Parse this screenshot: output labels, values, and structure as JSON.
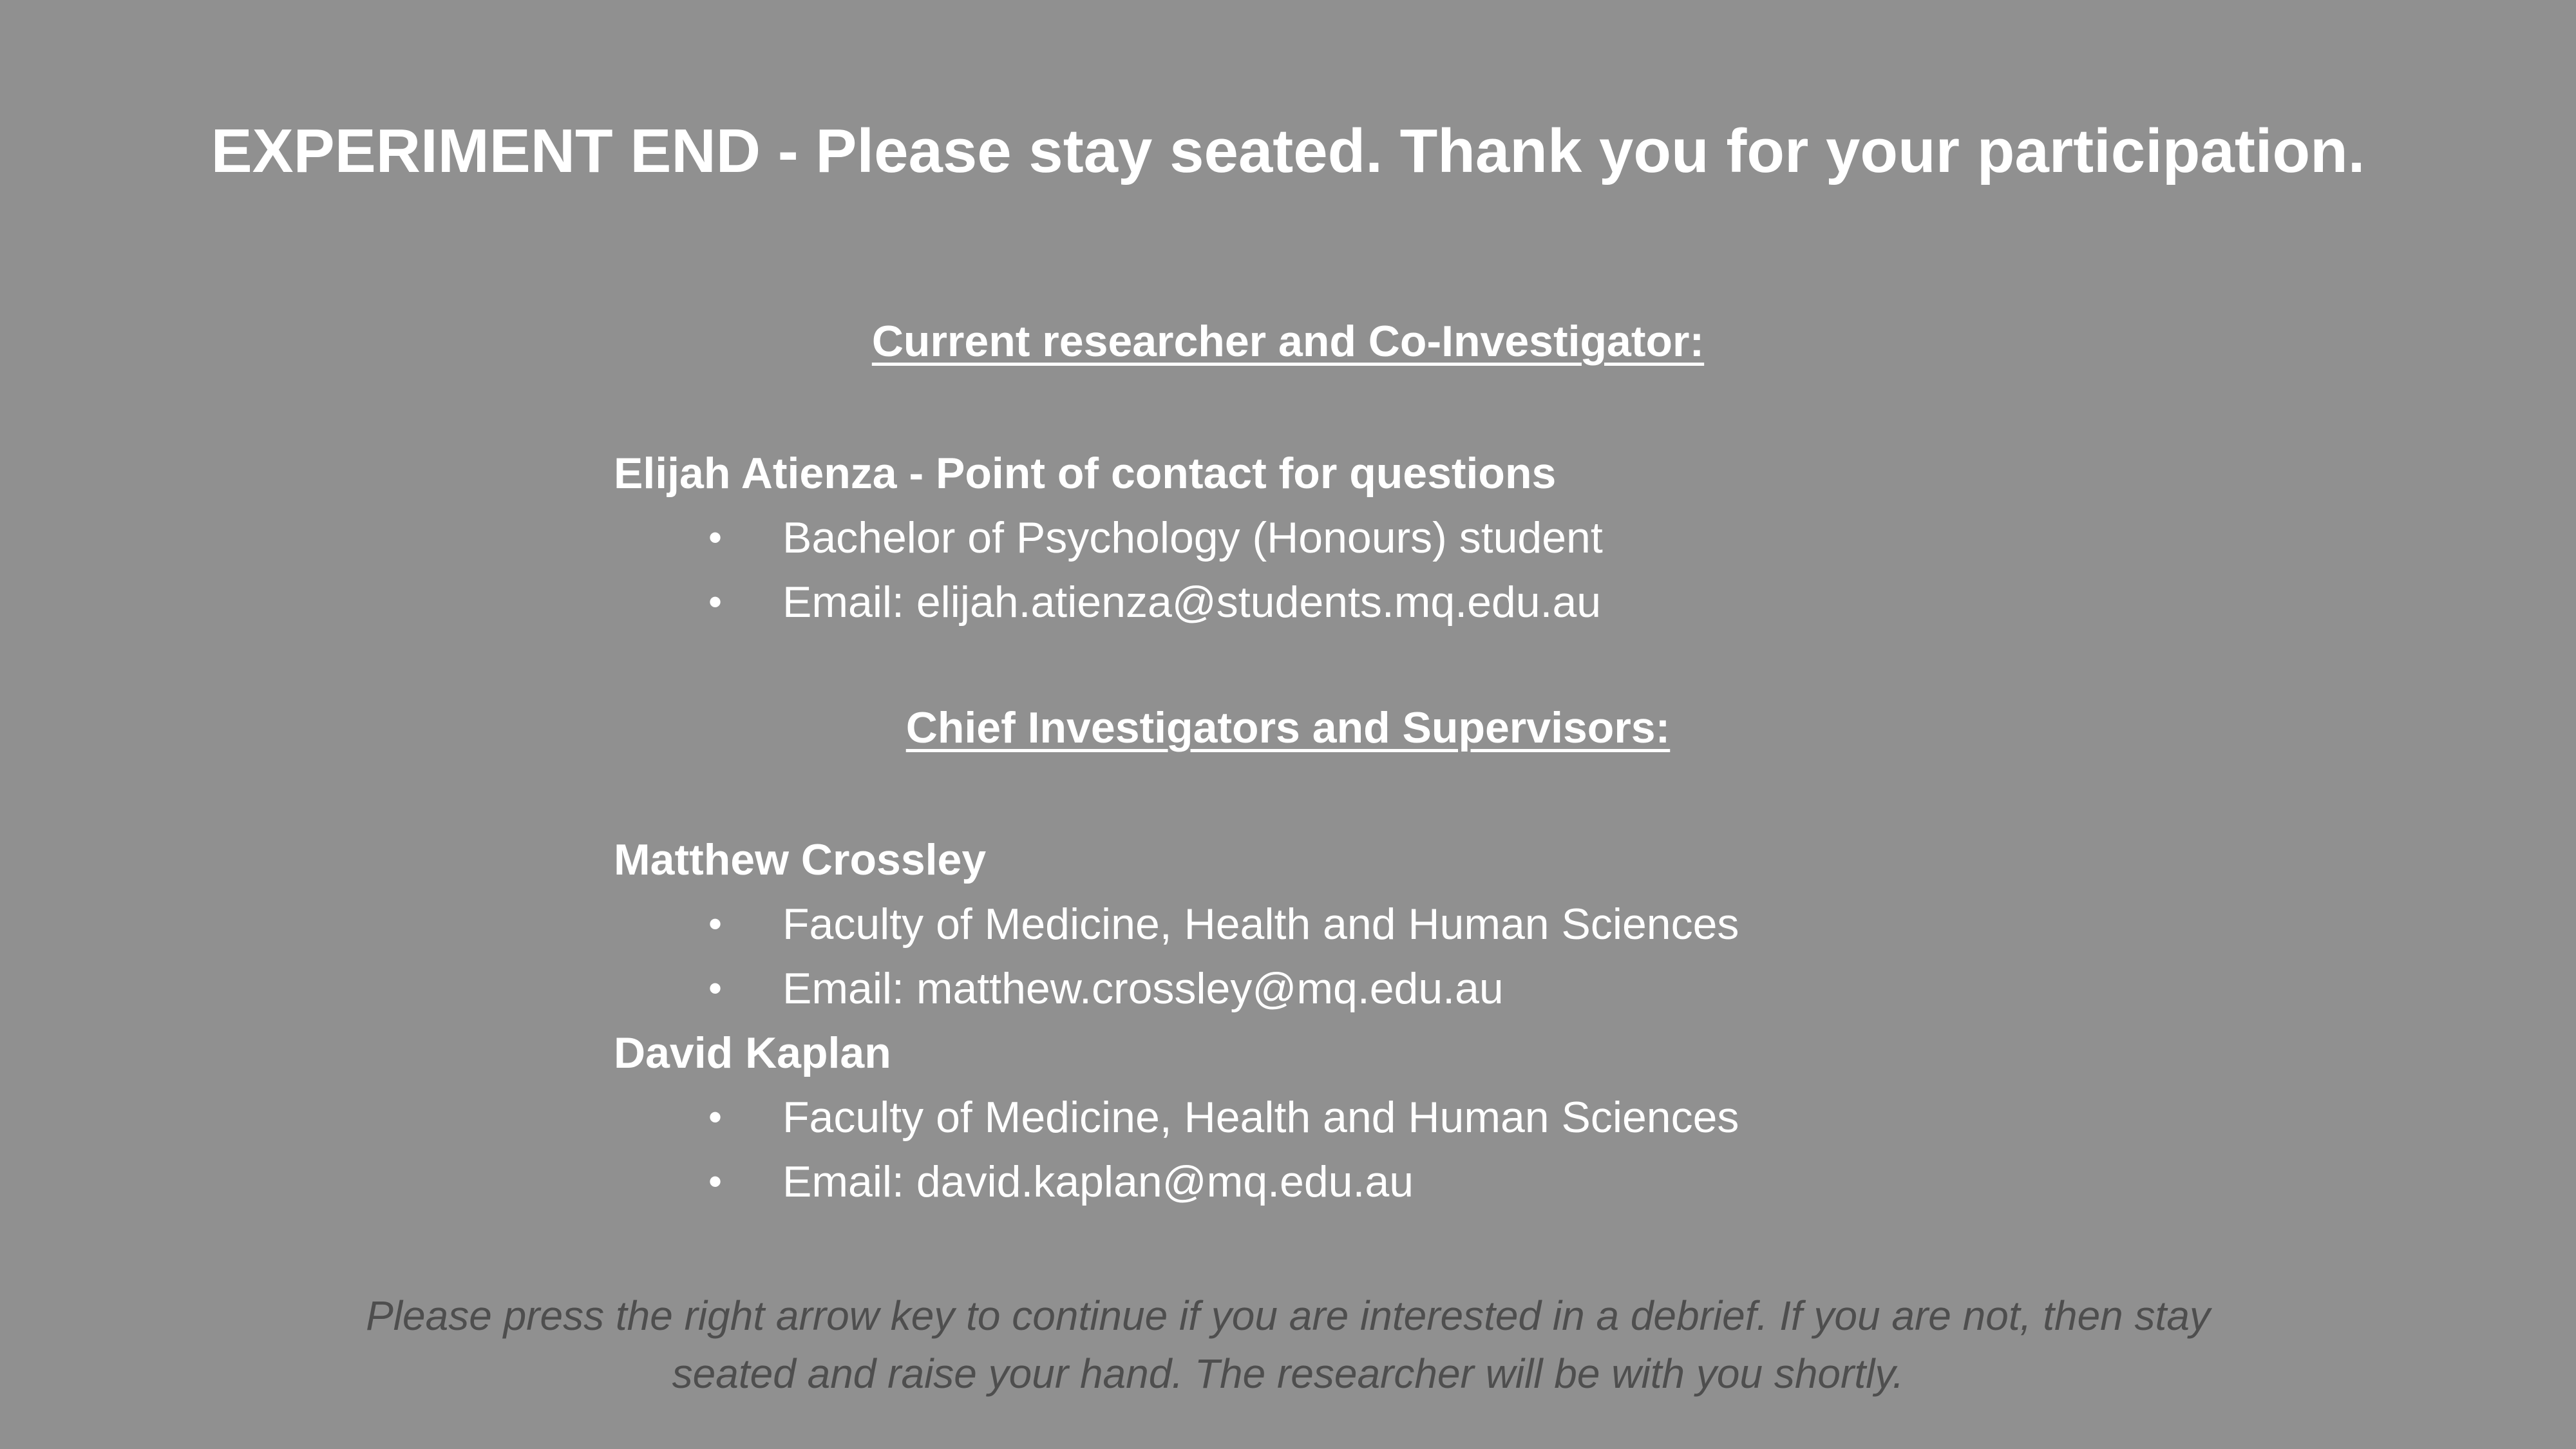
{
  "background_color": "#909090",
  "text_color": "#ffffff",
  "footer_color": "#4e4e4e",
  "headline": "EXPERIMENT END - Please stay seated. Thank you for your participation.",
  "sections": {
    "current": {
      "heading": "Current researcher and Co-Investigator:",
      "contacts": [
        {
          "name": "Elijah Atienza - Point of contact for questions",
          "details": [
            "Bachelor of Psychology (Honours) student",
            "Email: elijah.atienza@students.mq.edu.au"
          ]
        }
      ]
    },
    "chief": {
      "heading": "Chief Investigators and Supervisors:",
      "contacts": [
        {
          "name": "Matthew Crossley",
          "details": [
            "Faculty of Medicine, Health and Human Sciences",
            "Email: matthew.crossley@mq.edu.au"
          ]
        },
        {
          "name": "David Kaplan",
          "details": [
            "Faculty of Medicine, Health and Human Sciences",
            "Email: david.kaplan@mq.edu.au"
          ]
        }
      ]
    }
  },
  "bullet_glyph": "•",
  "footer": {
    "line1": "Please press the right arrow key to continue if you are interested in a debrief. If you are not, then stay",
    "line2": "seated and raise your hand. The researcher will be with you shortly."
  }
}
